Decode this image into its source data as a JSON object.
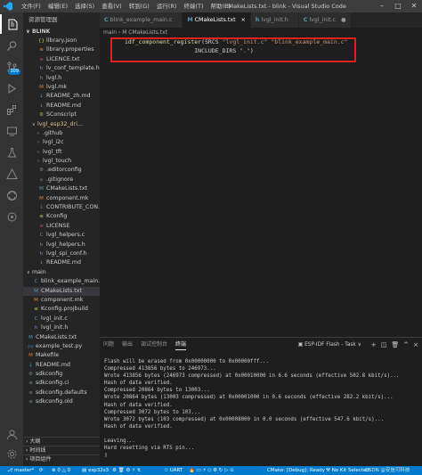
{
  "titlebar": {
    "menus": [
      "文件(F)",
      "编辑(E)",
      "选择(S)",
      "查看(V)",
      "转到(G)",
      "运行(R)",
      "终端(T)",
      "帮助(H)"
    ],
    "title": "CMakeLists.txt - blink - Visual Studio Code"
  },
  "activity": {
    "badge": "309"
  },
  "sidebar": {
    "header": "资源管理器",
    "project": "BLINK",
    "tree": [
      {
        "label": "library.json",
        "icon": "{}",
        "color": "#cbcb41",
        "indent": 2
      },
      {
        "label": "library.properties",
        "icon": "≡",
        "color": "#e37933",
        "indent": 2
      },
      {
        "label": "LICENCE.txt",
        "icon": "≡",
        "color": "#cc3e44",
        "indent": 2
      },
      {
        "label": "lv_conf_template.h",
        "icon": "h",
        "color": "#a074c4",
        "indent": 2
      },
      {
        "label": "lvgl.h",
        "icon": "h",
        "color": "#a074c4",
        "indent": 2
      },
      {
        "label": "lvgl.mk",
        "icon": "M",
        "color": "#e37933",
        "indent": 2
      },
      {
        "label": "README_zh.md",
        "icon": "↓",
        "color": "#519aba",
        "indent": 2
      },
      {
        "label": "README.md",
        "icon": "↓",
        "color": "#519aba",
        "indent": 2
      },
      {
        "label": "SConscript",
        "icon": "⚙",
        "color": "#8dc149",
        "indent": 2
      },
      {
        "label": "lvgl_esp32_dri...",
        "icon": "",
        "chev": "∨",
        "indent": 1,
        "modified": true
      },
      {
        "label": ".github",
        "icon": "",
        "chev": "›",
        "indent": 2
      },
      {
        "label": "lvgl_i2c",
        "icon": "",
        "chev": "›",
        "indent": 2
      },
      {
        "label": "lvgl_tft",
        "icon": "",
        "chev": "›",
        "indent": 2
      },
      {
        "label": "lvgl_touch",
        "icon": "",
        "chev": "›",
        "indent": 2
      },
      {
        "label": ".editorconfig",
        "icon": "⚙",
        "color": "#6d8086",
        "indent": 2
      },
      {
        "label": ".gitignore",
        "icon": "◆",
        "color": "#41535b",
        "indent": 2
      },
      {
        "label": "CMakeLists.txt",
        "icon": "M",
        "color": "#519aba",
        "indent": 2
      },
      {
        "label": "component.mk",
        "icon": "M",
        "color": "#e37933",
        "indent": 2
      },
      {
        "label": "CONTRIBUTE_CON...",
        "icon": "↓",
        "color": "#519aba",
        "indent": 2
      },
      {
        "label": "Kconfig",
        "icon": "≡",
        "color": "#cbcb41",
        "indent": 2
      },
      {
        "label": "LICENSE",
        "icon": "≡",
        "color": "#cc3e44",
        "indent": 2
      },
      {
        "label": "lvgl_helpers.c",
        "icon": "C",
        "color": "#519aba",
        "indent": 2
      },
      {
        "label": "lvgl_helpers.h",
        "icon": "h",
        "color": "#a074c4",
        "indent": 2
      },
      {
        "label": "lvgl_spi_conf.h",
        "icon": "h",
        "color": "#a074c4",
        "indent": 2
      },
      {
        "label": "README.md",
        "icon": "↓",
        "color": "#519aba",
        "indent": 2
      },
      {
        "label": "main",
        "icon": "",
        "chev": "∨",
        "indent": 0
      },
      {
        "label": "blink_example_main.c",
        "icon": "C",
        "color": "#519aba",
        "indent": 1
      },
      {
        "label": "CMakeLists.txt",
        "icon": "M",
        "color": "#519aba",
        "indent": 1,
        "selected": true
      },
      {
        "label": "component.mk",
        "icon": "M",
        "color": "#e37933",
        "indent": 1
      },
      {
        "label": "Kconfig.projbuild",
        "icon": "≡",
        "color": "#cbcb41",
        "indent": 1
      },
      {
        "label": "lvgl_init.c",
        "icon": "C",
        "color": "#519aba",
        "indent": 1
      },
      {
        "label": "lvgl_init.h",
        "icon": "h",
        "color": "#a074c4",
        "indent": 1
      },
      {
        "label": "CMakeLists.txt",
        "icon": "M",
        "color": "#519aba",
        "indent": 0
      },
      {
        "label": "example_test.py",
        "icon": "py",
        "color": "#3572a5",
        "indent": 0
      },
      {
        "label": "Makefile",
        "icon": "M",
        "color": "#e37933",
        "indent": 0
      },
      {
        "label": "README.md",
        "icon": "↓",
        "color": "#519aba",
        "indent": 0
      },
      {
        "label": "sdkconfig",
        "icon": "⚙",
        "color": "#6d8086",
        "indent": 0
      },
      {
        "label": "sdkconfig.ci",
        "icon": "≡",
        "color": "#6d8086",
        "indent": 0
      },
      {
        "label": "sdkconfig.defaults",
        "icon": "≡",
        "color": "#6d8086",
        "indent": 0
      },
      {
        "label": "sdkconfig.old",
        "icon": "≡",
        "color": "#6d8086",
        "indent": 0
      }
    ],
    "footers": [
      "大纲",
      "时间线",
      "项目组件"
    ]
  },
  "tabs": [
    {
      "label": "blink_example_main.c",
      "icon": "C",
      "close": ""
    },
    {
      "label": "CMakeLists.txt",
      "icon": "M",
      "close": "×",
      "active": true
    },
    {
      "label": "lvgl_init.h",
      "icon": "h",
      "close": ""
    },
    {
      "label": "lvgl_init.c",
      "icon": "C",
      "close": "●"
    }
  ],
  "breadcrumb": "main › M CMakeLists.txt",
  "code": {
    "line1_fn": "idf_component_register",
    "line1_a": "(SRCS ",
    "line1_s1": "\"lvgl_init.c\"",
    "line1_s2": "\"blink_example_main.c\"",
    "line2_a": "                    INCLUDE_DIRS ",
    "line2_s": "\".\"",
    "line2_b": ")"
  },
  "panel": {
    "tabs": [
      "问题",
      "输出",
      "调试控制台",
      "终端"
    ],
    "active_tab": "终端",
    "terminal_select": "ESP-IDF Flash - Task",
    "terminal_lines": [
      "Flash will be erased from 0x00000000 to 0x00000fff...",
      "Compressed 413856 bytes to 246973...",
      "Wrote 413856 bytes (246973 compressed) at 0x00010000 in 6.6 seconds (effective 502.8 kbit/s)...",
      "Hash of data verified.",
      "Compressed 20864 bytes to 13003...",
      "Wrote 20864 bytes (13003 compressed) at 0x00001000 in 0.6 seconds (effective 282.2 kbit/s)...",
      "Hash of data verified.",
      "Compressed 3072 bytes to 103...",
      "Wrote 3072 bytes (103 compressed) at 0x00008000 in 0.0 seconds (effective 547.6 kbit/s)...",
      "Hash of data verified.",
      "",
      "Leaving...",
      "Hard resetting via RTS pin...",
      "▯"
    ]
  },
  "statusbar": {
    "branch": "master*",
    "sync": "⟳",
    "errors": "⊗ 0 △ 0",
    "target": "esp32s3",
    "uart": "UART",
    "cmake": "CMake: [Debug]: Ready",
    "kit": "No Kit Selected",
    "watermark": "CSDN @安信可科技"
  }
}
